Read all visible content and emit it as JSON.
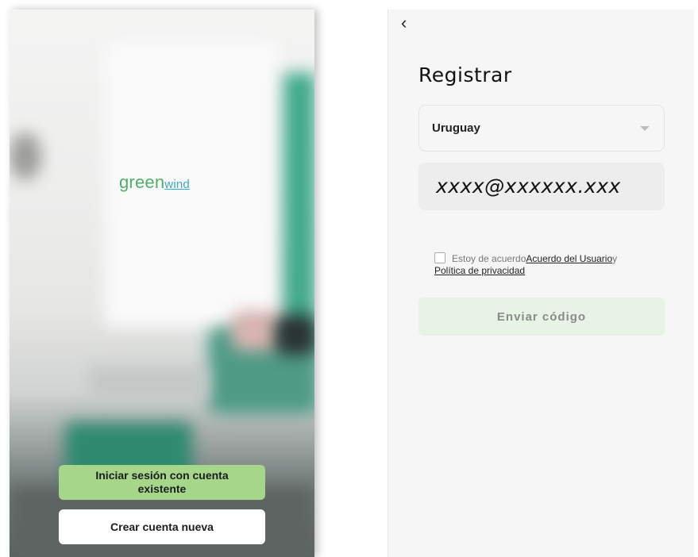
{
  "welcome": {
    "logo_part1": "green",
    "logo_part2": "wind",
    "login_button": "Iniciar sesión con cuenta existente",
    "create_button": "Crear cuenta nueva"
  },
  "register": {
    "back_icon": "chevron-left",
    "title": "Registrar",
    "country": "Uruguay",
    "email_value": "xxxx@xxxxxx.xxx",
    "agree_prefix": "Estoy de acuerdo",
    "agree_link": "Acuerdo del Usuario",
    "agree_suffix": "y",
    "privacy_link": "Política de privacidad",
    "send_button": "Enviar código"
  },
  "colors": {
    "login_button": "#a5d68a",
    "send_button_disabled": "#e7f3e4",
    "logo_green": "#4fae6a",
    "logo_blue": "#38a7c9"
  }
}
